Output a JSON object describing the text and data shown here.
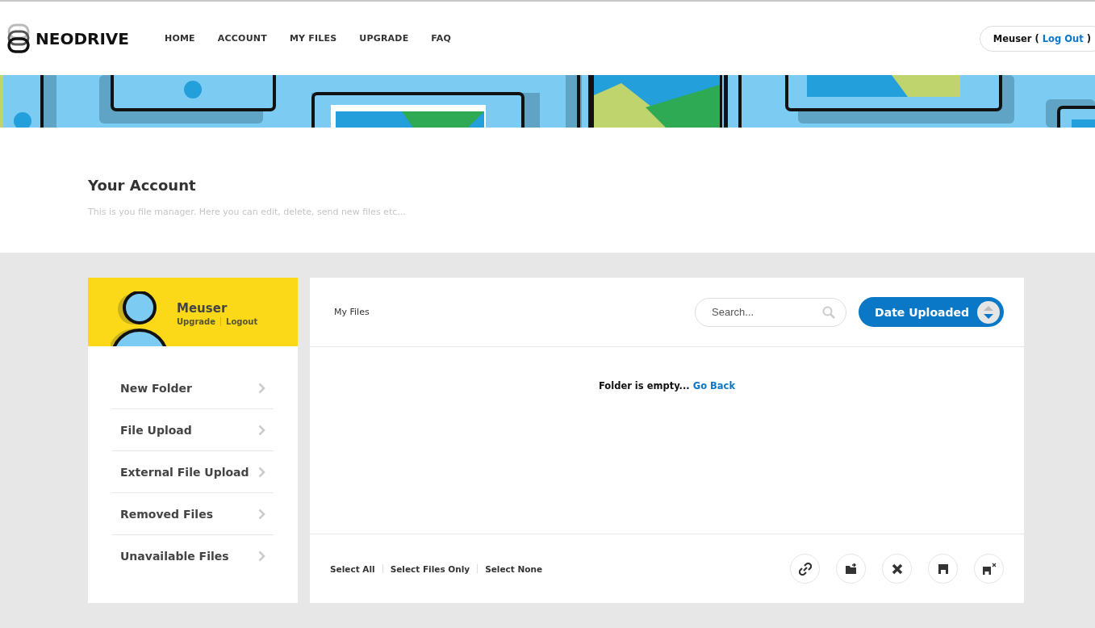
{
  "header": {
    "logo": "NEODRIVE",
    "nav": [
      "HOME",
      "ACCOUNT",
      "MY FILES",
      "UPGRADE",
      "FAQ"
    ],
    "user": {
      "name": "Meuser",
      "open": "(",
      "logout": "Log Out",
      "close": ")"
    }
  },
  "intro": {
    "title": "Your Account",
    "subtitle": "This is you file manager. Here you can edit, delete, send new files etc..."
  },
  "profile": {
    "name": "Meuser",
    "links": [
      "Upgrade",
      "Logout"
    ]
  },
  "sidebar": {
    "items": [
      "New Folder",
      "File Upload",
      "External File Upload",
      "Removed Files",
      "Unavailable Files"
    ]
  },
  "main": {
    "breadcrumb": "My Files",
    "search": {
      "placeholder": "Search..."
    },
    "sort": {
      "label": "Date Uploaded"
    },
    "empty": {
      "message": "Folder is empty...",
      "link": "Go Back"
    },
    "selection": [
      "Select All",
      "Select Files Only",
      "Select None"
    ]
  }
}
